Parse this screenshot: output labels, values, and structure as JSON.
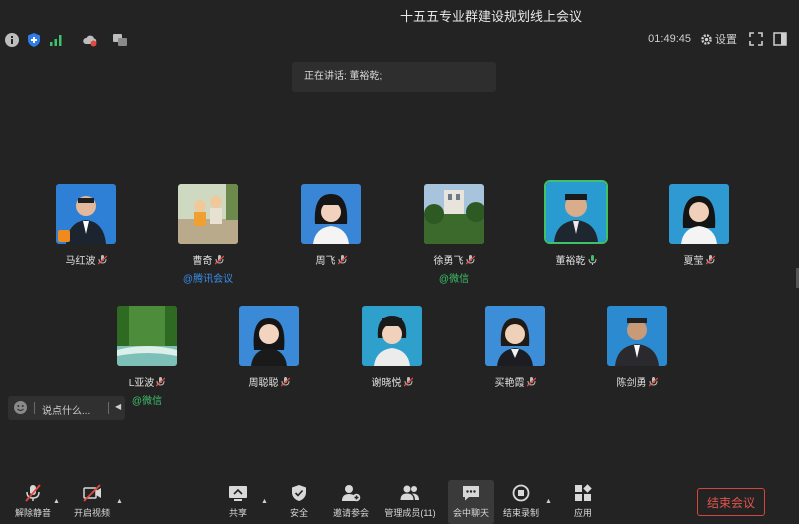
{
  "window": {
    "title": "十五五专业群建设规划线上会议"
  },
  "status": {
    "clock": "01:49:45",
    "settings_label": "设置"
  },
  "speaking": {
    "text": "正在讲话: 董裕乾;"
  },
  "participants": [
    {
      "name": "马红波"
    },
    {
      "name": "曹奇",
      "via": "@腾讯会议"
    },
    {
      "name": "周飞"
    },
    {
      "name": "徐勇飞",
      "via": "@微信"
    },
    {
      "name": "董裕乾"
    },
    {
      "name": "夏莹"
    },
    {
      "name": "L亚波",
      "via": "@微信"
    },
    {
      "name": "周聪聪"
    },
    {
      "name": "谢晓悦"
    },
    {
      "name": "买艳霞"
    },
    {
      "name": "陈剑勇"
    }
  ],
  "chat": {
    "placeholder": "说点什么..."
  },
  "toolbar": {
    "unmute": "解除静音",
    "video": "开启视频",
    "share": "共享",
    "security": "安全",
    "invite": "邀请参会",
    "manage": "管理成员(11)",
    "chat": "会中聊天",
    "record": "结束录制",
    "apps": "应用",
    "end": "结束会议"
  },
  "colors": {
    "accent_green": "#3ec16a",
    "end_red": "#d2473c",
    "link_blue": "#3a8de8"
  }
}
